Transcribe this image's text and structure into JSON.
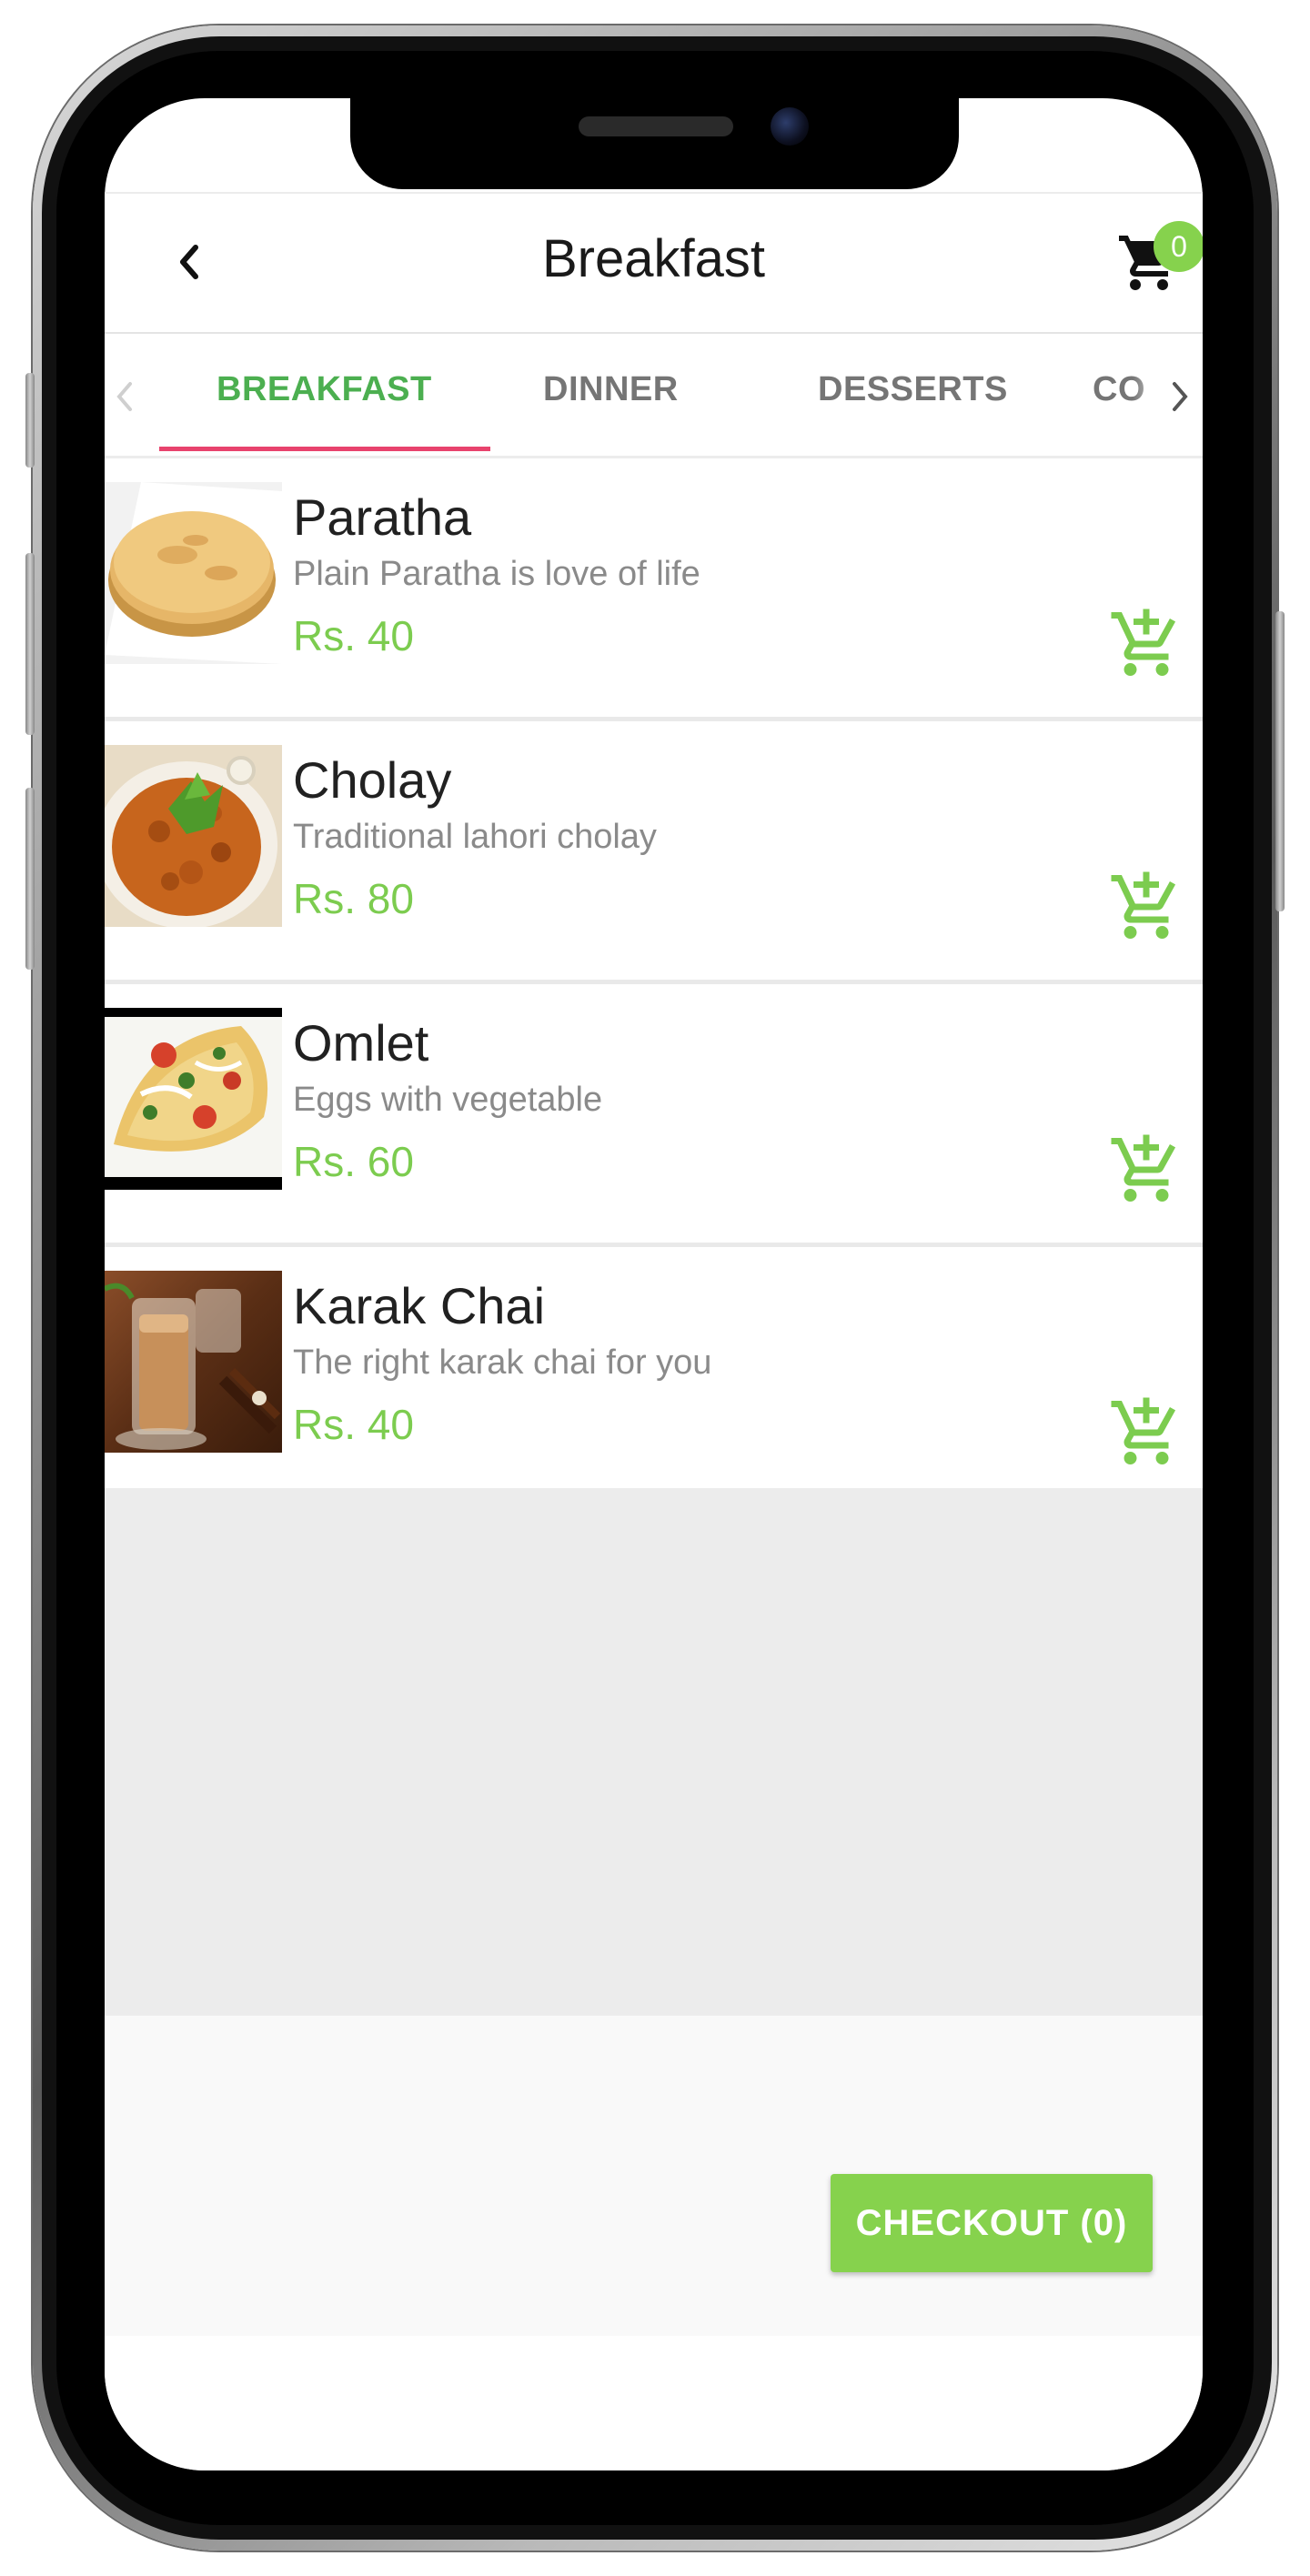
{
  "header": {
    "title": "Breakfast",
    "back_icon": "chevron-left-icon",
    "cart_icon": "shopping-cart-icon",
    "cart_count": "0"
  },
  "tabs": {
    "items": [
      {
        "label": "BREAKFAST",
        "active": true
      },
      {
        "label": "DINNER",
        "active": false
      },
      {
        "label": "DESSERTS",
        "active": false
      },
      {
        "label": "CO",
        "active": false
      }
    ],
    "scroll_left_icon": "chevron-left-icon",
    "scroll_right_icon": "chevron-right-icon"
  },
  "products": [
    {
      "name": "Paratha",
      "description": "Plain Paratha is love of life",
      "price": "Rs. 40",
      "image": "paratha-photo"
    },
    {
      "name": "Cholay",
      "description": "Traditional lahori cholay",
      "price": "Rs. 80",
      "image": "cholay-photo"
    },
    {
      "name": "Omlet",
      "description": "Eggs with vegetable",
      "price": "Rs. 60",
      "image": "omlet-photo"
    },
    {
      "name": "Karak Chai",
      "description": "The right karak chai for you",
      "price": "Rs. 40",
      "image": "karak-chai-photo"
    }
  ],
  "checkout": {
    "label": "CHECKOUT (0)"
  },
  "colors": {
    "accent_green": "#86d24d",
    "price_green": "#7ccc4f",
    "active_tab_green": "#4caf50",
    "tab_indicator": "#e8436d"
  }
}
